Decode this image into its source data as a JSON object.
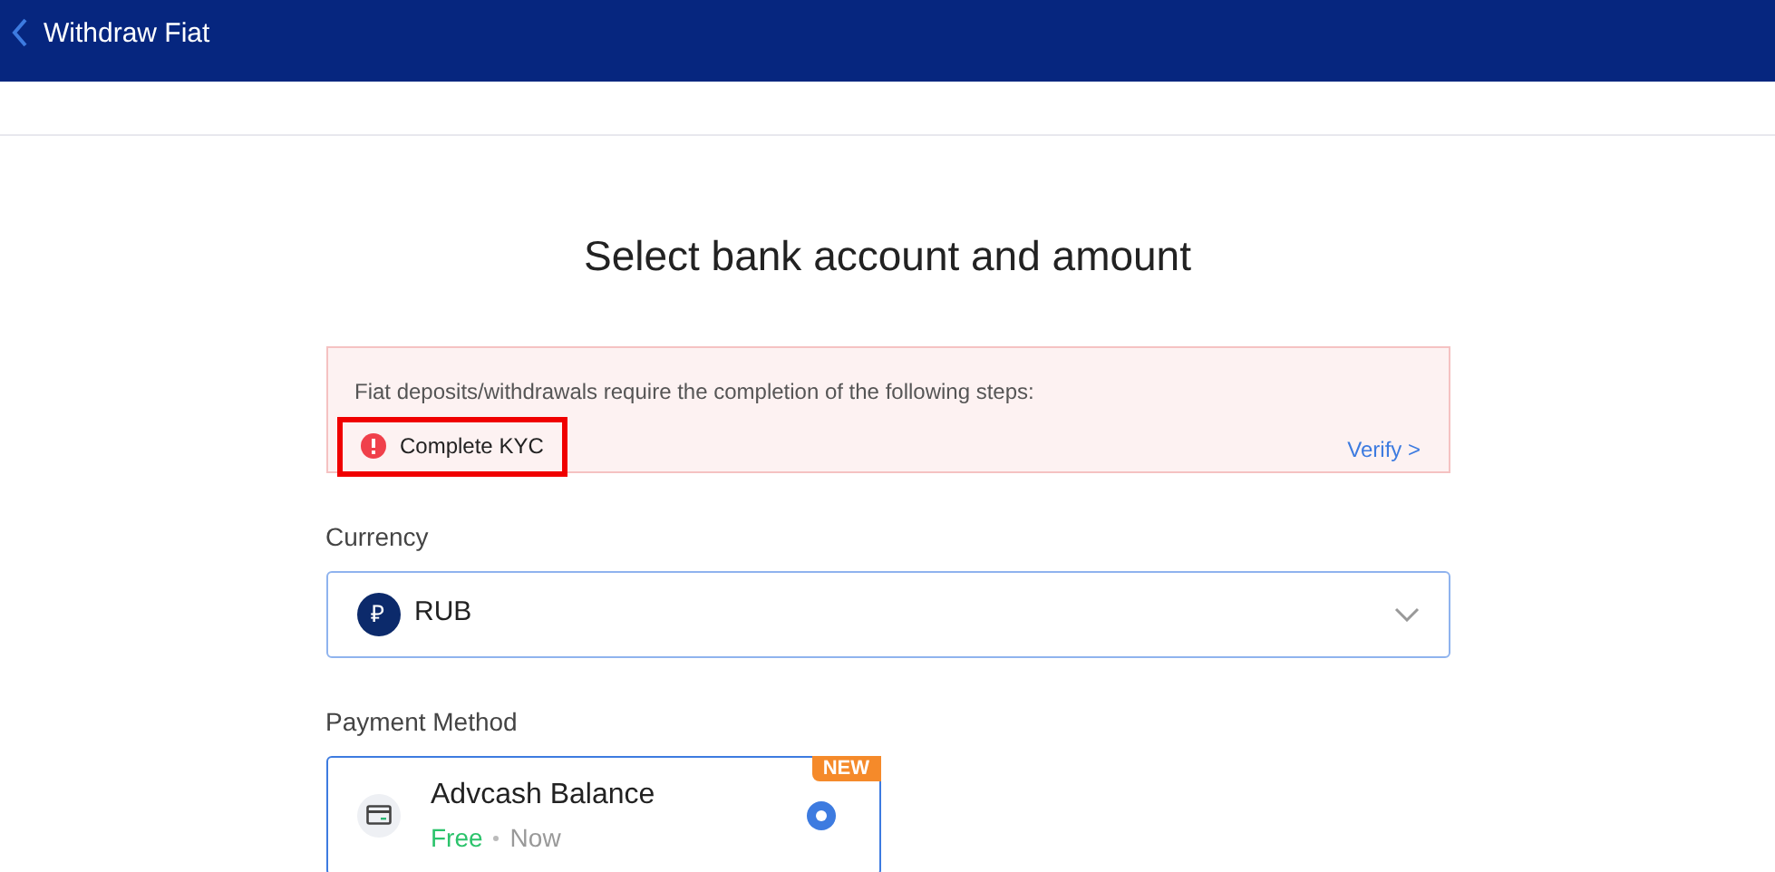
{
  "header": {
    "title": "Withdraw Fiat"
  },
  "heading": "Select bank account and amount",
  "notice": {
    "message": "Fiat deposits/withdrawals require the completion of the following steps:",
    "steps": [
      {
        "label": "Complete KYC",
        "highlighted": true
      }
    ],
    "action": "Verify >"
  },
  "currency": {
    "label": "Currency",
    "symbol": "₽",
    "value": "RUB"
  },
  "payment_method": {
    "label": "Payment Method",
    "options": [
      {
        "name": "Advcash Balance",
        "fee": "Free",
        "time": "Now",
        "badge": "NEW",
        "selected": true
      }
    ]
  }
}
